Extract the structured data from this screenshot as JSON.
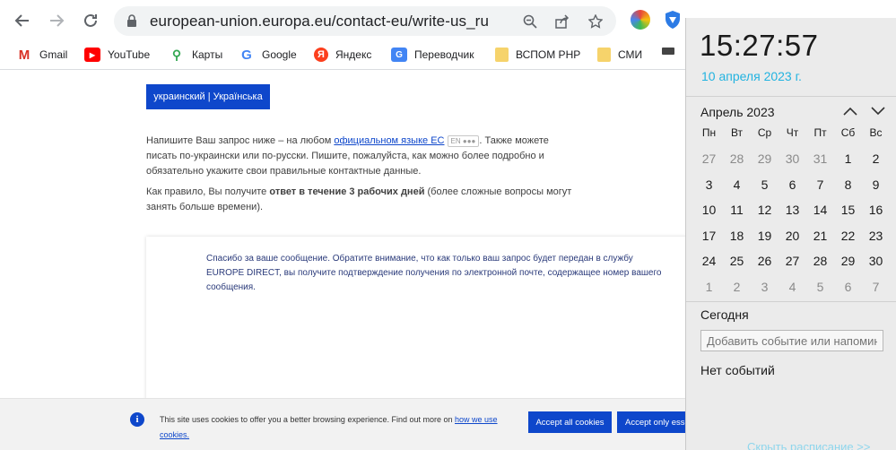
{
  "browser": {
    "url": "european-union.europa.eu/contact-eu/write-us_ru",
    "bookmarks": [
      {
        "label": "Gmail",
        "icon": "gmail-icon"
      },
      {
        "label": "YouTube",
        "icon": "youtube-icon"
      },
      {
        "label": "Карты",
        "icon": "maps-icon"
      },
      {
        "label": "Google",
        "icon": "google-icon"
      },
      {
        "label": "Яндекс",
        "icon": "yandex-icon"
      },
      {
        "label": "Переводчик",
        "icon": "translate-icon"
      },
      {
        "label": "ВСПОМ PHP",
        "icon": "folder-icon"
      },
      {
        "label": "СМИ",
        "icon": "folder-icon"
      }
    ]
  },
  "page": {
    "language_button": "украинский | Українська",
    "intro_1": "Напишите Ваш запрос ниже – на любом ",
    "intro_link": "официальном языке ЕС",
    "intro_tag": "EN ●●●",
    "intro_2": ". Также можете писать по-украински или по-русски. Пишите, пожалуйста, как можно более подробно и обязательно укажите свои правильные контактные данные.",
    "rule_1": "Как правило, Вы получите ",
    "rule_bold": "ответ в течение 3 рабочих дней",
    "rule_2": " (более сложные вопросы могут занять больше времени).",
    "thanks": "Спасибо за ваше сообщение. Обратите внимание, что как только ваш запрос будет передан в службу EUROPE DIRECT, вы получите подтверждение получения по электронной почте, содержащее номер вашего сообщения."
  },
  "cookie": {
    "text": "This site uses cookies to offer you a better browsing experience. Find out more on ",
    "link": "how we use cookies.",
    "accept_all": "Accept all cookies",
    "accept_essential": "Accept only essential cookies"
  },
  "calendar": {
    "time": "15:27:57",
    "date": "10 апреля 2023 г.",
    "month": "Апрель 2023",
    "weekdays": [
      "Пн",
      "Вт",
      "Ср",
      "Чт",
      "Пт",
      "Сб",
      "Вс"
    ],
    "days": [
      {
        "d": "27",
        "other": true
      },
      {
        "d": "28",
        "other": true
      },
      {
        "d": "29",
        "other": true
      },
      {
        "d": "30",
        "other": true
      },
      {
        "d": "31",
        "other": true
      },
      {
        "d": "1"
      },
      {
        "d": "2"
      },
      {
        "d": "3"
      },
      {
        "d": "4"
      },
      {
        "d": "5"
      },
      {
        "d": "6"
      },
      {
        "d": "7"
      },
      {
        "d": "8"
      },
      {
        "d": "9"
      },
      {
        "d": "10",
        "today": true
      },
      {
        "d": "11"
      },
      {
        "d": "12"
      },
      {
        "d": "13"
      },
      {
        "d": "14"
      },
      {
        "d": "15"
      },
      {
        "d": "16"
      },
      {
        "d": "17"
      },
      {
        "d": "18"
      },
      {
        "d": "19"
      },
      {
        "d": "20"
      },
      {
        "d": "21"
      },
      {
        "d": "22"
      },
      {
        "d": "23"
      },
      {
        "d": "24"
      },
      {
        "d": "25"
      },
      {
        "d": "26"
      },
      {
        "d": "27"
      },
      {
        "d": "28"
      },
      {
        "d": "29"
      },
      {
        "d": "30"
      },
      {
        "d": "1",
        "other": true
      },
      {
        "d": "2",
        "other": true
      },
      {
        "d": "3",
        "other": true
      },
      {
        "d": "4",
        "other": true
      },
      {
        "d": "5",
        "other": true
      },
      {
        "d": "6",
        "other": true
      },
      {
        "d": "7",
        "other": true
      }
    ],
    "today_label": "Сегодня",
    "event_placeholder": "Добавить событие или напоминание",
    "no_events": "Нет событий",
    "schedule_link": "Скрыть расписание >>"
  },
  "colors": {
    "eu_blue": "#0e47cb",
    "accent_cyan": "#22b3e0"
  }
}
